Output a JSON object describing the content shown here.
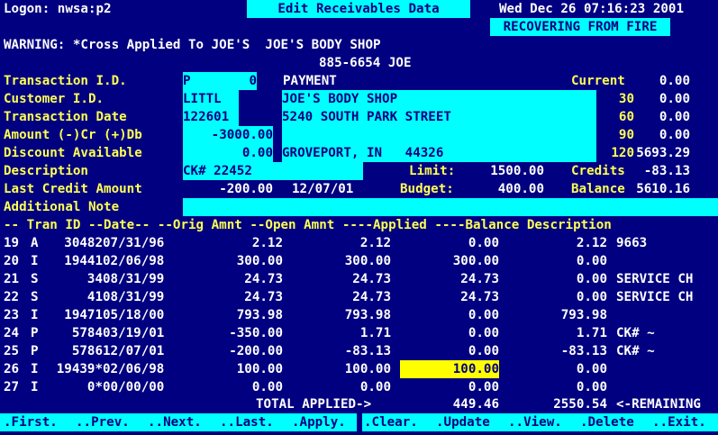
{
  "header": {
    "logon": "Logon: nwsa:p2",
    "title": "Edit Receivables Data",
    "datetime": "Wed Dec 26 07:16:23 2001",
    "status": "RECOVERING FROM FIRE"
  },
  "warning": {
    "line1": "WARNING: *Cross Applied To JOE'S  JOE'S BODY SHOP",
    "line2": "885-6654 JOE"
  },
  "form": {
    "transaction_id_label": "Transaction I.D.",
    "transaction_id_type": "P",
    "transaction_id_value": "0",
    "transaction_type": "PAYMENT",
    "customer_id_label": "Customer I.D.",
    "customer_id": "LITTL",
    "customer_name": "JOE'S BODY SHOP",
    "transaction_date_label": "Transaction Date",
    "transaction_date": "122601",
    "address": "5240 SOUTH PARK STREET",
    "amount_label": "Amount (-)Cr (+)Db",
    "amount": "-3000.00",
    "discount_label": "Discount Available",
    "discount": "0.00",
    "city": "GROVEPORT, IN   44326",
    "description_label": "Description",
    "description": "CK# 22452",
    "last_credit_label": "Last Credit Amount",
    "last_credit_amount": "-200.00",
    "last_credit_date": "12/07/01",
    "additional_note_label": "Additional Note",
    "additional_note": ""
  },
  "aging": {
    "current_label": "Current",
    "current": "0.00",
    "d30_label": "30",
    "d30": "0.00",
    "d60_label": "60",
    "d60": "0.00",
    "d90_label": "90",
    "d90": "0.00",
    "d120_label": "120",
    "d120": "5693.29",
    "limit_label": "Limit:",
    "limit": "1500.00",
    "credits_label": "Credits",
    "credits": "-83.13",
    "budget_label": "Budget:",
    "budget": "400.00",
    "balance_label": "Balance",
    "balance": "5610.16"
  },
  "table": {
    "header": "-- Tran ID --Date-- --Orig Amnt --Open Amnt ----Applied ----Balance Description",
    "rows": [
      {
        "n": "19",
        "t": "A",
        "id": "30482",
        "date": "07/31/96",
        "orig": "2.12",
        "open": "2.12",
        "applied": "0.00",
        "bal": "2.12",
        "desc": "9663"
      },
      {
        "n": "20",
        "t": "I",
        "id": "19441",
        "date": "02/06/98",
        "orig": "300.00",
        "open": "300.00",
        "applied": "300.00",
        "bal": "0.00",
        "desc": ""
      },
      {
        "n": "21",
        "t": "S",
        "id": "34",
        "date": "08/31/99",
        "orig": "24.73",
        "open": "24.73",
        "applied": "24.73",
        "bal": "0.00",
        "desc": "SERVICE CH"
      },
      {
        "n": "22",
        "t": "S",
        "id": "41",
        "date": "08/31/99",
        "orig": "24.73",
        "open": "24.73",
        "applied": "24.73",
        "bal": "0.00",
        "desc": "SERVICE CH"
      },
      {
        "n": "23",
        "t": "I",
        "id": "19471",
        "date": "05/18/00",
        "orig": "793.98",
        "open": "793.98",
        "applied": "0.00",
        "bal": "793.98",
        "desc": ""
      },
      {
        "n": "24",
        "t": "P",
        "id": "5784",
        "date": "03/19/01",
        "orig": "-350.00",
        "open": "1.71",
        "applied": "0.00",
        "bal": "1.71",
        "desc": "CK# ~"
      },
      {
        "n": "25",
        "t": "P",
        "id": "5786",
        "date": "12/07/01",
        "orig": "-200.00",
        "open": "-83.13",
        "applied": "0.00",
        "bal": "-83.13",
        "desc": "CK# ~"
      },
      {
        "n": "26",
        "t": "I",
        "id": "19439*",
        "date": "02/06/98",
        "orig": "100.00",
        "open": "100.00",
        "applied": "100.00",
        "bal": "0.00",
        "desc": ""
      },
      {
        "n": "27",
        "t": "I",
        "id": "0*",
        "date": "00/00/00",
        "orig": "0.00",
        "open": "0.00",
        "applied": "0.00",
        "bal": "0.00",
        "desc": ""
      }
    ],
    "total_label": "TOTAL APPLIED->",
    "total_applied": "449.46",
    "remaining": "2550.54",
    "remaining_label": "<-REMAINING"
  },
  "menu": {
    "first": ".First.",
    "prev": "..Prev.",
    "next": "..Next.",
    "last": "..Last.",
    "apply": ".Apply.",
    "clear": ".Clear.",
    "update": ".Update",
    "view": "..View.",
    "delete": ".Delete",
    "exit": "..Exit."
  },
  "colors": {
    "background": "#000080",
    "field": "#00ffff",
    "label": "#ffff55",
    "highlight": "#ffff00"
  }
}
